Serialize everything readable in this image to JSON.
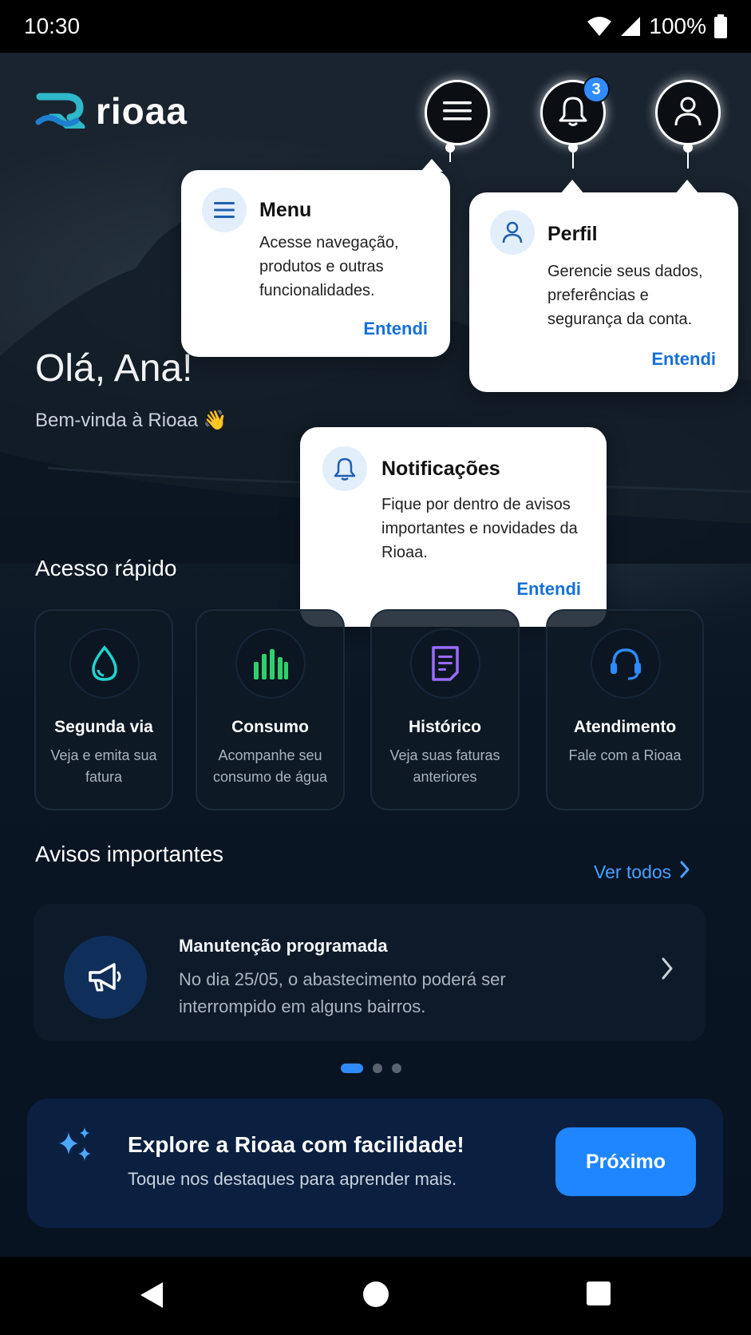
{
  "status_bar": {
    "time": "10:30",
    "battery": "100%",
    "icons": [
      "wifi-icon",
      "signal-icon",
      "battery-icon"
    ]
  },
  "header": {
    "brand": "rioaa",
    "notification_count": "3",
    "buttons": [
      "menu-icon",
      "bell-icon",
      "user-icon"
    ]
  },
  "greeting": {
    "title": "Olá, Ana!",
    "subtitle": "Bem-vinda à Rioaa 👋"
  },
  "tooltips": {
    "menu": {
      "title": "Menu",
      "body": "Acesse navegação, produtos e outras funcionalidades.",
      "action": "Entendi"
    },
    "profile": {
      "title": "Perfil",
      "body": "Gerencie seus dados, preferências e segurança da conta.",
      "action": "Entendi"
    },
    "notifications": {
      "title": "Notificações",
      "body": "Fique por dentro de avisos importantes e novidades da Rioaa.",
      "action": "Entendi"
    }
  },
  "quick_access": {
    "title": "Acesso rápido",
    "items": [
      {
        "title": "Segunda via",
        "desc": "Veja e emita sua fatura",
        "icon": "water-drop-icon"
      },
      {
        "title": "Consumo",
        "desc": "Acompanhe seu consumo de água",
        "icon": "bar-chart-icon"
      },
      {
        "title": "Histórico",
        "desc": "Veja suas faturas anteriores",
        "icon": "document-icon"
      },
      {
        "title": "Atendimento",
        "desc": "Fale com a Rioaa",
        "icon": "headset-icon"
      }
    ]
  },
  "notices": {
    "title": "Avisos importantes",
    "see_all": "Ver todos",
    "card": {
      "title": "Manutenção programada",
      "body": "No dia 25/05, o abastecimento poderá ser interrompido em alguns bairros.",
      "icon": "megaphone-icon"
    },
    "pages": 3,
    "active_page": 1
  },
  "tour": {
    "title": "Explore a Rioaa com facilidade!",
    "subtitle": "Toque nos destaques para aprender mais.",
    "button": "Próximo",
    "icon": "sparkles-icon"
  },
  "colors": {
    "accent": "#1f86ff",
    "link": "#4aa0ff",
    "tooltip_action": "#1570d8",
    "background": "#0a1624"
  }
}
